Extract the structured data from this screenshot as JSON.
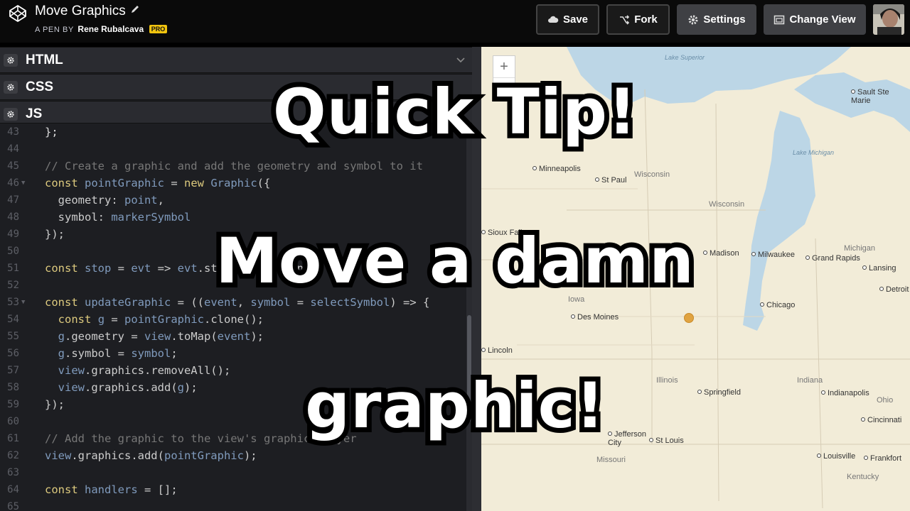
{
  "header": {
    "pen_title": "Move Graphics",
    "pen_by_prefix": "A PEN BY",
    "author": "Rene Rubalcava",
    "pro_badge": "PRO",
    "buttons": {
      "save": "Save",
      "fork": "Fork",
      "settings": "Settings",
      "change_view": "Change View"
    }
  },
  "editor": {
    "panels": [
      {
        "label": "HTML"
      },
      {
        "label": "CSS"
      },
      {
        "label": "JS"
      }
    ],
    "line_numbers": [
      "43",
      "44",
      "45",
      "46",
      "47",
      "48",
      "49",
      "50",
      "51",
      "52",
      "53",
      "54",
      "55",
      "56",
      "57",
      "58",
      "59",
      "60",
      "61",
      "62",
      "63",
      "64",
      "65"
    ],
    "code_lines": [
      "};",
      "",
      "// Create a graphic and add the geometry and symbol to it",
      "const pointGraphic = new Graphic({",
      "  geometry: point,",
      "  symbol: markerSymbol",
      "});",
      "",
      "const stop = evt => evt.stopPropagation();",
      "",
      "const updateGraphic = ((event, symbol = selectSymbol) => {",
      "  const g = pointGraphic.clone();",
      "  g.geometry = view.toMap(event);",
      "  g.symbol = symbol;",
      "  view.graphics.removeAll();",
      "  view.graphics.add(g);",
      "});",
      "",
      "// Add the graphic to the view's graphics layer",
      "view.graphics.add(pointGraphic);",
      "",
      "const handlers = [];",
      ""
    ]
  },
  "map": {
    "zoom_in": "+",
    "zoom_out": "−",
    "cities": [
      "Minneapolis",
      "St Paul",
      "Sioux Falls",
      "Des Moines",
      "Madison",
      "Milwaukee",
      "Chicago",
      "Grand Rapids",
      "Lansing",
      "Detroit",
      "Sault Ste Marie",
      "Springfield",
      "Indianapolis",
      "Cincinnati",
      "Lincoln",
      "Jefferson City",
      "St Louis",
      "Louisville",
      "Frankfort"
    ],
    "states": [
      "Wisconsin",
      "Michigan",
      "Iowa",
      "Illinois",
      "Indiana",
      "Missouri",
      "Kentucky",
      "Ohio"
    ],
    "water": [
      "Lake Superior",
      "Lake Michigan"
    ],
    "colors": {
      "land": "#f2ecd8",
      "water": "#bcd6e6",
      "marker": "#e0a341"
    }
  },
  "overlay": {
    "line1": "Quick Tip!",
    "line2": "Move a damn",
    "line3": "graphic!"
  }
}
